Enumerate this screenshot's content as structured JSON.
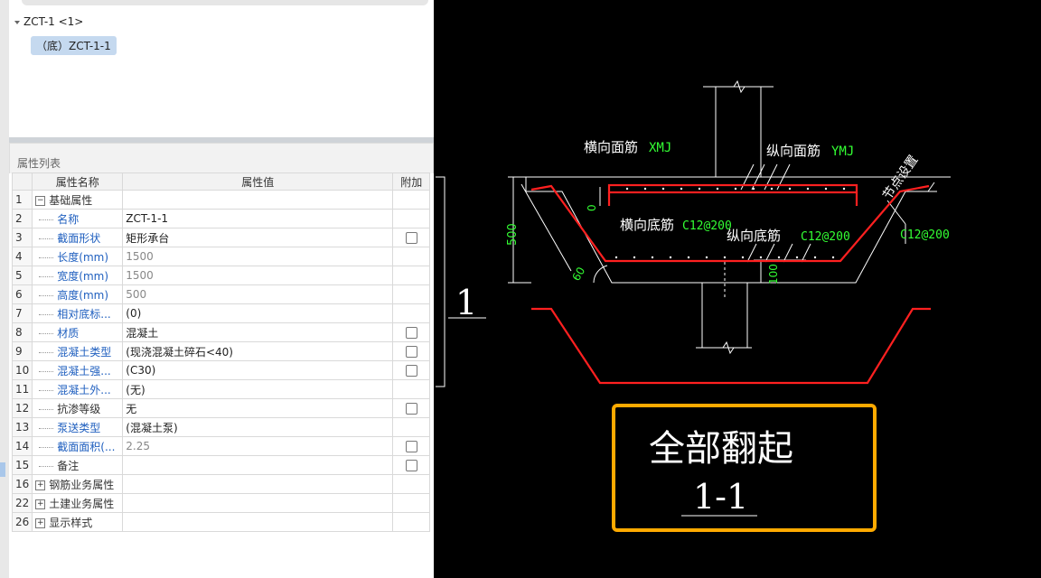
{
  "tree": {
    "root_label": "ZCT-1 <1>",
    "child_label": "（底）ZCT-1-1"
  },
  "props": {
    "title": "属性列表",
    "headers": {
      "name": "属性名称",
      "value": "属性值",
      "add": "附加"
    },
    "rows": [
      {
        "num": "1",
        "name": "基础属性",
        "value": "",
        "group": true,
        "expanded": true,
        "checkbox": false,
        "blue": false,
        "grey": false
      },
      {
        "num": "2",
        "name": "名称",
        "value": "ZCT-1-1",
        "checkbox": false,
        "blue": true,
        "grey": false
      },
      {
        "num": "3",
        "name": "截面形状",
        "value": "矩形承台",
        "checkbox": true,
        "blue": true,
        "grey": false
      },
      {
        "num": "4",
        "name": "长度(mm)",
        "value": "1500",
        "checkbox": false,
        "blue": true,
        "grey": true
      },
      {
        "num": "5",
        "name": "宽度(mm)",
        "value": "1500",
        "checkbox": false,
        "blue": true,
        "grey": true
      },
      {
        "num": "6",
        "name": "高度(mm)",
        "value": "500",
        "checkbox": false,
        "blue": true,
        "grey": true
      },
      {
        "num": "7",
        "name": "相对底标...",
        "value": "(0)",
        "checkbox": false,
        "blue": true,
        "grey": false
      },
      {
        "num": "8",
        "name": "材质",
        "value": "混凝土",
        "checkbox": true,
        "blue": true,
        "grey": false
      },
      {
        "num": "9",
        "name": "混凝土类型",
        "value": "(现浇混凝土碎石<40)",
        "checkbox": true,
        "blue": true,
        "grey": false
      },
      {
        "num": "10",
        "name": "混凝土强...",
        "value": "(C30)",
        "checkbox": true,
        "blue": true,
        "grey": false
      },
      {
        "num": "11",
        "name": "混凝土外...",
        "value": "(无)",
        "checkbox": false,
        "blue": true,
        "grey": false
      },
      {
        "num": "12",
        "name": "抗渗等级",
        "value": "无",
        "checkbox": true,
        "blue": false,
        "grey": false
      },
      {
        "num": "13",
        "name": "泵送类型",
        "value": "(混凝土泵)",
        "checkbox": false,
        "blue": true,
        "grey": false
      },
      {
        "num": "14",
        "name": "截面面积(...",
        "value": "2.25",
        "checkbox": true,
        "blue": true,
        "grey": true
      },
      {
        "num": "15",
        "name": "备注",
        "value": "",
        "checkbox": true,
        "blue": false,
        "grey": false
      },
      {
        "num": "16",
        "name": "钢筋业务属性",
        "value": "",
        "group": true,
        "expanded": false,
        "checkbox": false,
        "blue": false,
        "grey": false
      },
      {
        "num": "22",
        "name": "土建业务属性",
        "value": "",
        "group": true,
        "expanded": false,
        "checkbox": false,
        "blue": false,
        "grey": false
      },
      {
        "num": "26",
        "name": "显示样式",
        "value": "",
        "group": true,
        "expanded": false,
        "checkbox": false,
        "blue": false,
        "grey": false
      }
    ]
  },
  "cad": {
    "labels": {
      "top_transverse": "横向面筋",
      "top_transverse_code": "XMJ",
      "top_longitudinal": "纵向面筋",
      "top_longitudinal_code": "YMJ",
      "node_setting": "节点设置",
      "bottom_transverse": "横向底筋",
      "bottom_transverse_code": "C12@200",
      "bottom_longitudinal": "纵向底筋",
      "bottom_longitudinal_code": "C12@200",
      "side_code": "C12@200",
      "dim_500": "500",
      "dim_0": "0",
      "dim_100": "100",
      "angle": "60",
      "section_marker": "1"
    },
    "callout": {
      "line1": "全部翻起",
      "line2": "1-1"
    },
    "colors": {
      "rebar": "#ff2020",
      "dim_text": "#33ff33",
      "callout_border": "#ffaa00",
      "line": "#ffffff"
    }
  }
}
